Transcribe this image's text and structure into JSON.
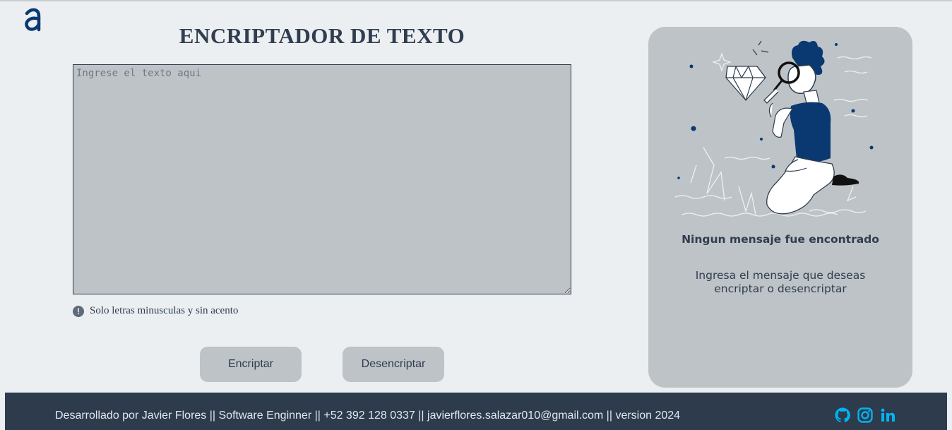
{
  "brand": {
    "logo_icon": "alura-a-logo-icon",
    "accent": "#0a3871"
  },
  "header": {
    "title": "ENCRIPTADOR DE TEXTO"
  },
  "editor": {
    "placeholder": "Ingrese el texto aqui",
    "value": ""
  },
  "hint": {
    "icon": "exclamation-circle-icon",
    "text": "Solo letras minusculas y sin acento"
  },
  "actions": {
    "encrypt_label": "Encriptar",
    "decrypt_label": "Desencriptar"
  },
  "output_panel": {
    "illustration": "person-with-magnifying-glass-illustration",
    "title": "Ningun mensaje fue encontrado",
    "message": "Ingresa el mensaje que deseas encriptar o desencriptar"
  },
  "footer": {
    "text": "Desarrollado por Javier Flores || Software Enginner || +52 392 128 0337 || javierflores.salazar010@gmail.com || version 2024",
    "social": [
      "github-icon",
      "instagram-icon",
      "linkedin-icon"
    ],
    "icon_color": "#00b4f0"
  },
  "colors": {
    "background": "#eceff1",
    "panel": "#bec3c7",
    "text": "#2f3d4f",
    "footer": "#2d3b4d"
  }
}
